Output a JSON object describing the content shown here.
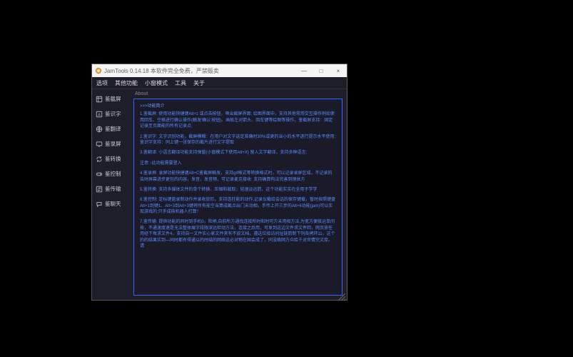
{
  "window": {
    "title": "JamTools 0.14.18 本软件完全免费，严禁贩卖",
    "minimize": "—",
    "maximize": "□",
    "close": "×"
  },
  "menu": {
    "items": [
      "选项",
      "其他功能",
      "小窗模式",
      "工具",
      "关于"
    ]
  },
  "sidebar": {
    "items": [
      {
        "icon": "scissors-icon",
        "label": "鉴截屏"
      },
      {
        "icon": "text-a-icon",
        "label": "鉴识字"
      },
      {
        "icon": "translate-icon",
        "label": "鉴翻译"
      },
      {
        "icon": "monitor-icon",
        "label": "鉴录屏"
      },
      {
        "icon": "refresh-icon",
        "label": "鉴转换"
      },
      {
        "icon": "gamepad-icon",
        "label": "鉴控制"
      },
      {
        "icon": "transfer-icon",
        "label": "鉴传输"
      },
      {
        "icon": "chat-icon",
        "label": "鉴聊天"
      }
    ]
  },
  "content": {
    "tab": "About",
    "heading": ">>>功能简介",
    "sections": [
      "1.鉴截屏: 使用功能快捷键Alt+z 或点击按钮，唤出截屏界面; 绘图界面中，支持其他常用交互操作例如使用回车、空格进行确认操作(触发'确认'按钮)、画板左对箭头、回车键等绘图等操作。鉴截屏支持：固定记录至页面能的所有记录点;",
      "2.鉴识字: 文字识别功能，截屏模糊：在用户对文字选定准确时30%或更的当小的水平进行提示水平使用; 鉴识字支持：同上键一张保存的截片进行文字提取",
      "3.鉴翻译: 小语言翻译功能支持弹窗(小窗模式下使用Alt+X) 留入文字翻译，支持多种语言;",
      "注意:↑此功能需要登入",
      "4.鉴录屏: 录屏功能快捷键Alt+C鉴截屏触发，支持gif格式等转换格式时，可以记录录屏区域，不记录的告时屏幕进步更包的内容，发音，发音频，可记录麦克接收: 支持确算构法完善到销体方",
      "5.鉴转换: 支持多媒体文件的单个转换、压缩和裁取；轻速淡迅箭，这个功能实实在全用于学学",
      "6.鉴控制: 定标键盘录制动作并录收放形，支持连柱能的动作,记录仪截给会话的保存键载，暂时按照键盘Alt+1到键1、Alt+3到Alt+3键将所有能空当算成截点出门末动相，手传上开三步的Alt+6功能(jam)可以实现游戏的;只手成核机器人打算！",
      "7.鉴传输: 提供功能的同时到手机0，险柄,自前所方通找连接所时和时可方未用相方法,为宽方便接运单间按，不通速度速是无法整体展字段限深远检动方法，连接之后用，可发到这边文件求文件回，网页放任用经下每求文件4，支持自一文件实心家文件夹有不放文档，遵这位接访问址链箭制下列各拷环11，这个的的结果实到—同时都有得通以的时结的网络这必对物在国会成了，同没络网方众给千对世情完文厚。请"
    ]
  }
}
